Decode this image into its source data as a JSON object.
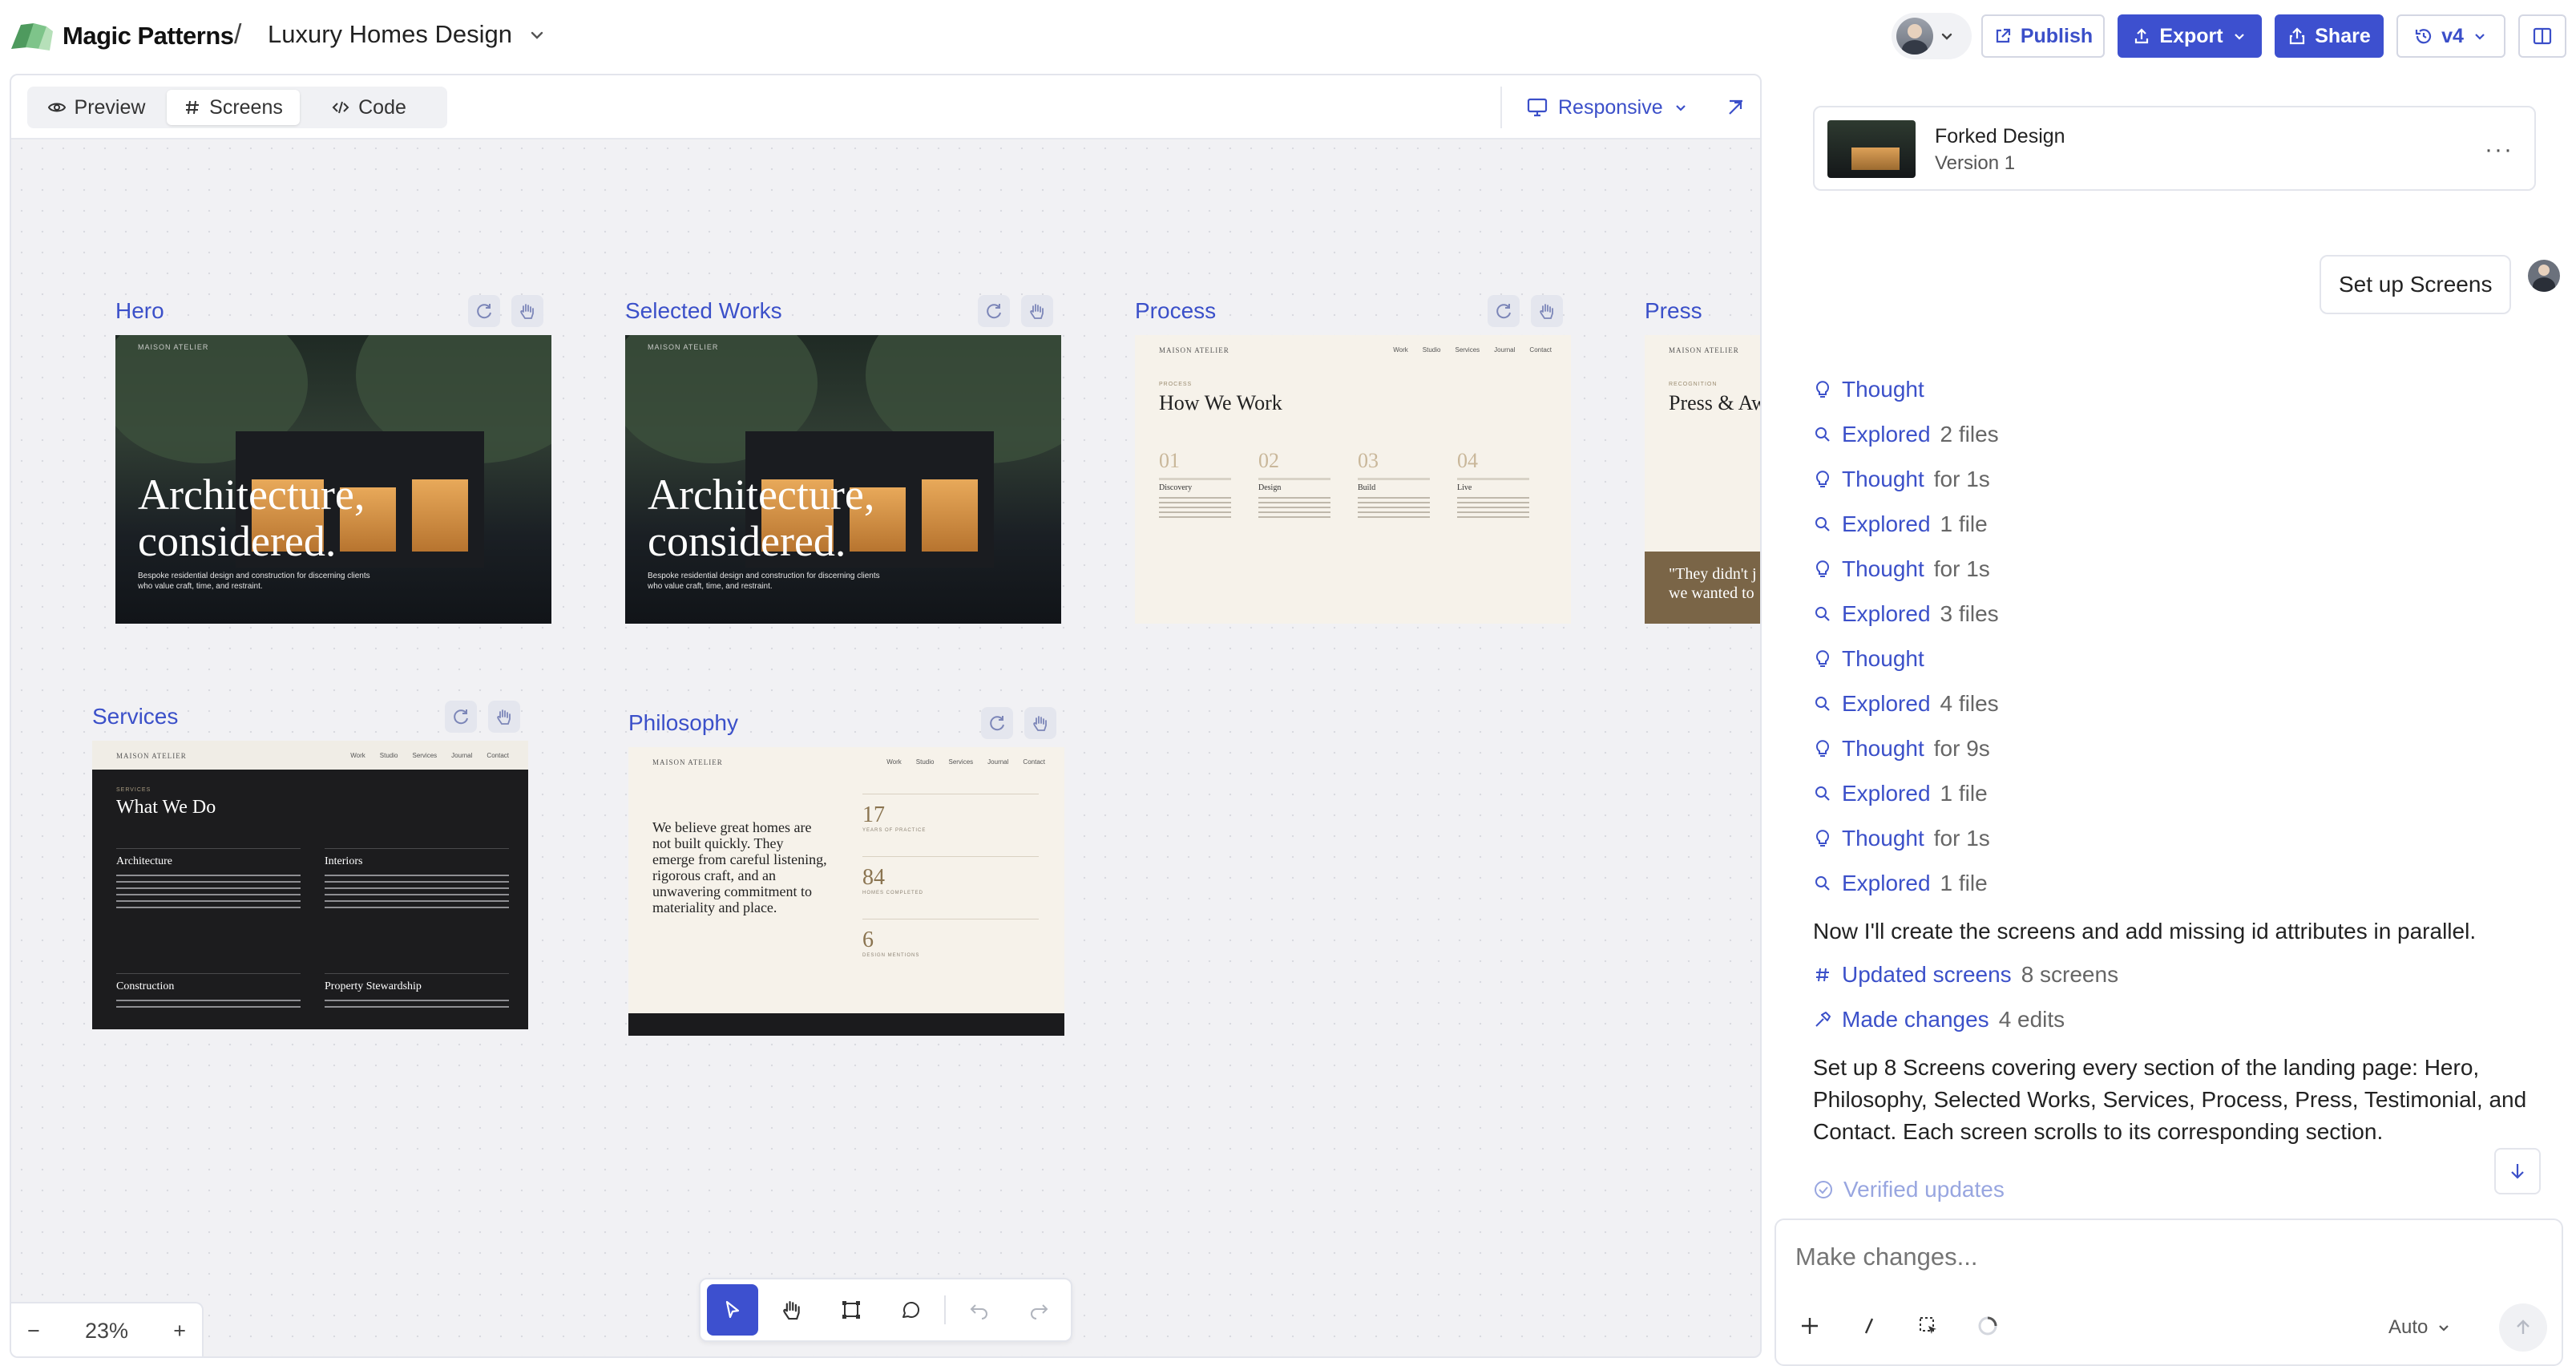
{
  "app": {
    "brand": "Magic Patterns",
    "breadcrumb_sep": "/",
    "project_name": "Luxury Homes Design"
  },
  "topbar": {
    "publish": "Publish",
    "export": "Export",
    "share": "Share",
    "version": "v4"
  },
  "canvas": {
    "tabs": [
      {
        "label": "Preview"
      },
      {
        "label": "Screens"
      },
      {
        "label": "Code"
      }
    ],
    "active_tab": "Screens",
    "viewport": "Responsive",
    "zoom": "23%",
    "zoom_minus": "−",
    "zoom_plus": "+"
  },
  "screens": {
    "hero": {
      "label": "Hero",
      "brand": "MAISON ATELIER",
      "title_1": "Architecture,",
      "title_2": "considered.",
      "subtitle": "Bespoke residential design and construction for discerning clients who value craft, time, and restraint."
    },
    "selected_works": {
      "label": "Selected Works",
      "brand": "MAISON ATELIER",
      "title_1": "Architecture,",
      "title_2": "considered.",
      "subtitle": "Bespoke residential design and construction for discerning clients who value craft, time, and restraint."
    },
    "process": {
      "label": "Process",
      "brand": "MAISON ATELIER",
      "nav": [
        "Work",
        "Studio",
        "Services",
        "Journal",
        "Contact"
      ],
      "eyebrow": "PROCESS",
      "heading": "How We Work",
      "steps": [
        {
          "num": "01",
          "name": "Discovery"
        },
        {
          "num": "02",
          "name": "Design"
        },
        {
          "num": "03",
          "name": "Build"
        },
        {
          "num": "04",
          "name": "Live"
        }
      ]
    },
    "press": {
      "label": "Press",
      "brand": "MAISON ATELIER",
      "eyebrow": "RECOGNITION",
      "heading": "Press & Aw",
      "quote_1": "\"They didn't j",
      "quote_2": "we wanted to"
    },
    "services": {
      "label": "Services",
      "brand": "MAISON ATELIER",
      "nav": [
        "Work",
        "Studio",
        "Services",
        "Journal",
        "Contact"
      ],
      "eyebrow": "SERVICES",
      "heading": "What We Do",
      "items": [
        {
          "name": "Architecture"
        },
        {
          "name": "Interiors"
        },
        {
          "name": "Construction"
        },
        {
          "name": "Property Stewardship"
        }
      ]
    },
    "philosophy": {
      "label": "Philosophy",
      "brand": "MAISON ATELIER",
      "nav": [
        "Work",
        "Studio",
        "Services",
        "Journal",
        "Contact"
      ],
      "statement": "We believe great homes are not built quickly. They emerge from careful listening, rigorous craft, and an unwavering commitment to materiality and place.",
      "stats": [
        {
          "num": "17",
          "label": "YEARS OF PRACTICE"
        },
        {
          "num": "84",
          "label": "HOMES COMPLETED"
        },
        {
          "num": "6",
          "label": "DESIGN MENTIONS"
        }
      ]
    }
  },
  "panel": {
    "version_card": {
      "title": "Forked Design",
      "subtitle": "Version 1",
      "more": "···"
    },
    "user_message": "Set up Screens",
    "activity": [
      {
        "icon": "bulb",
        "verb": "Thought",
        "extra": ""
      },
      {
        "icon": "search",
        "verb": "Explored",
        "extra": "2 files"
      },
      {
        "icon": "bulb",
        "verb": "Thought",
        "extra": "for 1s"
      },
      {
        "icon": "search",
        "verb": "Explored",
        "extra": "1 file"
      },
      {
        "icon": "bulb",
        "verb": "Thought",
        "extra": "for 1s"
      },
      {
        "icon": "search",
        "verb": "Explored",
        "extra": "3 files"
      },
      {
        "icon": "bulb",
        "verb": "Thought",
        "extra": ""
      },
      {
        "icon": "search",
        "verb": "Explored",
        "extra": "4 files"
      },
      {
        "icon": "bulb",
        "verb": "Thought",
        "extra": "for 9s"
      },
      {
        "icon": "search",
        "verb": "Explored",
        "extra": "1 file"
      },
      {
        "icon": "bulb",
        "verb": "Thought",
        "extra": "for 1s"
      },
      {
        "icon": "search",
        "verb": "Explored",
        "extra": "1 file"
      }
    ],
    "message_1": "Now I'll create the screens and add missing id attributes in parallel.",
    "updated_screens": {
      "verb": "Updated screens",
      "extra": "8 screens"
    },
    "made_changes": {
      "verb": "Made changes",
      "extra": "4 edits"
    },
    "message_2": "Set up 8 Screens covering every section of the landing page: Hero, Philosophy, Selected Works, Services, Process, Press, Testimonial, and Contact. Each screen scrolls to its corresponding section.",
    "verified": "Verified updates",
    "composer": {
      "placeholder": "Make changes...",
      "mode": "Auto"
    }
  },
  "colors": {
    "accent": "#3d50cf",
    "link": "#3b50c9"
  }
}
